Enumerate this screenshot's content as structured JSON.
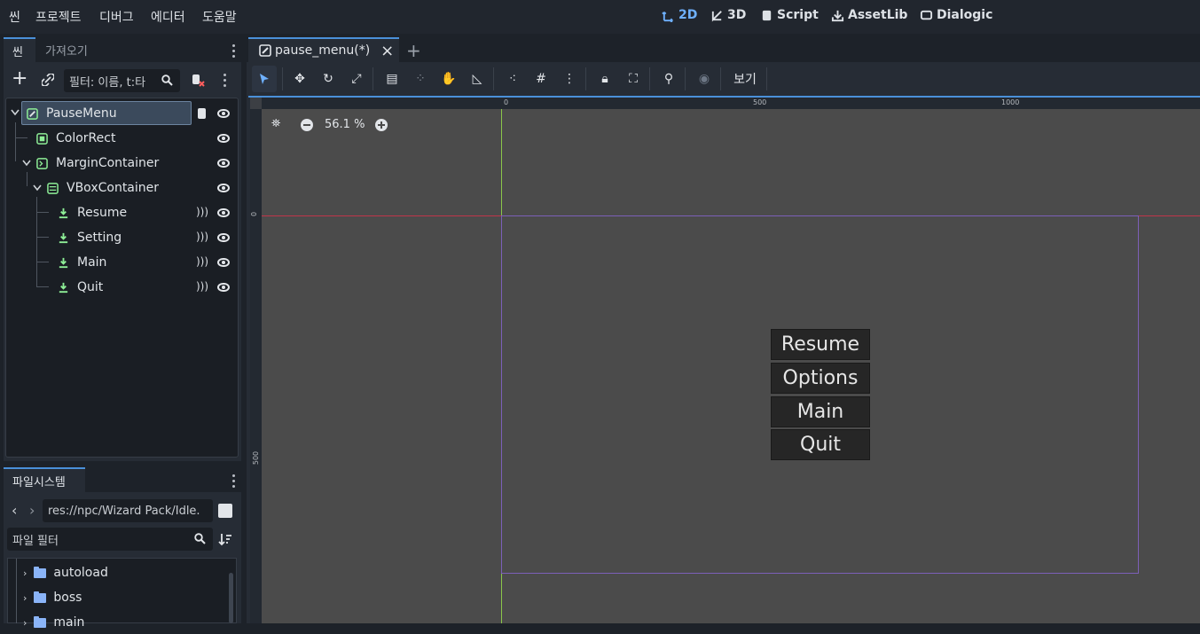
{
  "menu": {
    "items": [
      "씬",
      "프로젝트",
      "디버그",
      "에디터",
      "도움말"
    ]
  },
  "workspaces": [
    {
      "label": "2D",
      "icon": "2d-icon",
      "active": true
    },
    {
      "label": "3D",
      "icon": "3d-icon",
      "active": false
    },
    {
      "label": "Script",
      "icon": "script-icon",
      "active": false
    },
    {
      "label": "AssetLib",
      "icon": "assetlib-icon",
      "active": false
    },
    {
      "label": "Dialogic",
      "icon": "dialogic-icon",
      "active": false
    }
  ],
  "scene_dock": {
    "tabs": [
      "씬",
      "가져오기"
    ],
    "filter_placeholder": "필터: 이름, t:타",
    "tree": [
      {
        "label": "PauseMenu",
        "icon": "control-icon",
        "selected": true,
        "has_script": true
      },
      {
        "label": "ColorRect",
        "icon": "colorrect-icon"
      },
      {
        "label": "MarginContainer",
        "icon": "margincontainer-icon"
      },
      {
        "label": "VBoxContainer",
        "icon": "vboxcontainer-icon"
      },
      {
        "label": "Resume",
        "icon": "button-icon",
        "signal": true
      },
      {
        "label": "Setting",
        "icon": "button-icon",
        "signal": true
      },
      {
        "label": "Main",
        "icon": "button-icon",
        "signal": true
      },
      {
        "label": "Quit",
        "icon": "button-icon",
        "signal": true
      }
    ]
  },
  "filesystem_dock": {
    "tab": "파일시스템",
    "path": "res://npc/Wizard Pack/Idle.",
    "filter_placeholder": "파일 필터",
    "items": [
      "autoload",
      "boss",
      "main"
    ]
  },
  "editor": {
    "scene_tab": "pause_menu(*)",
    "view_menu": "보기",
    "zoom": "56.1 %",
    "ruler_top": [
      "0",
      "500",
      "1000"
    ],
    "ruler_left": [
      "0",
      "500"
    ],
    "game_buttons": [
      "Resume",
      "Options",
      "Main",
      "Quit"
    ]
  },
  "colors": {
    "accent": "#6fb1ff",
    "node_green": "#8eef97",
    "x_axis": "#c0354a",
    "y_axis": "#8ac64a",
    "viewport_bg": "#4b4b4b"
  }
}
